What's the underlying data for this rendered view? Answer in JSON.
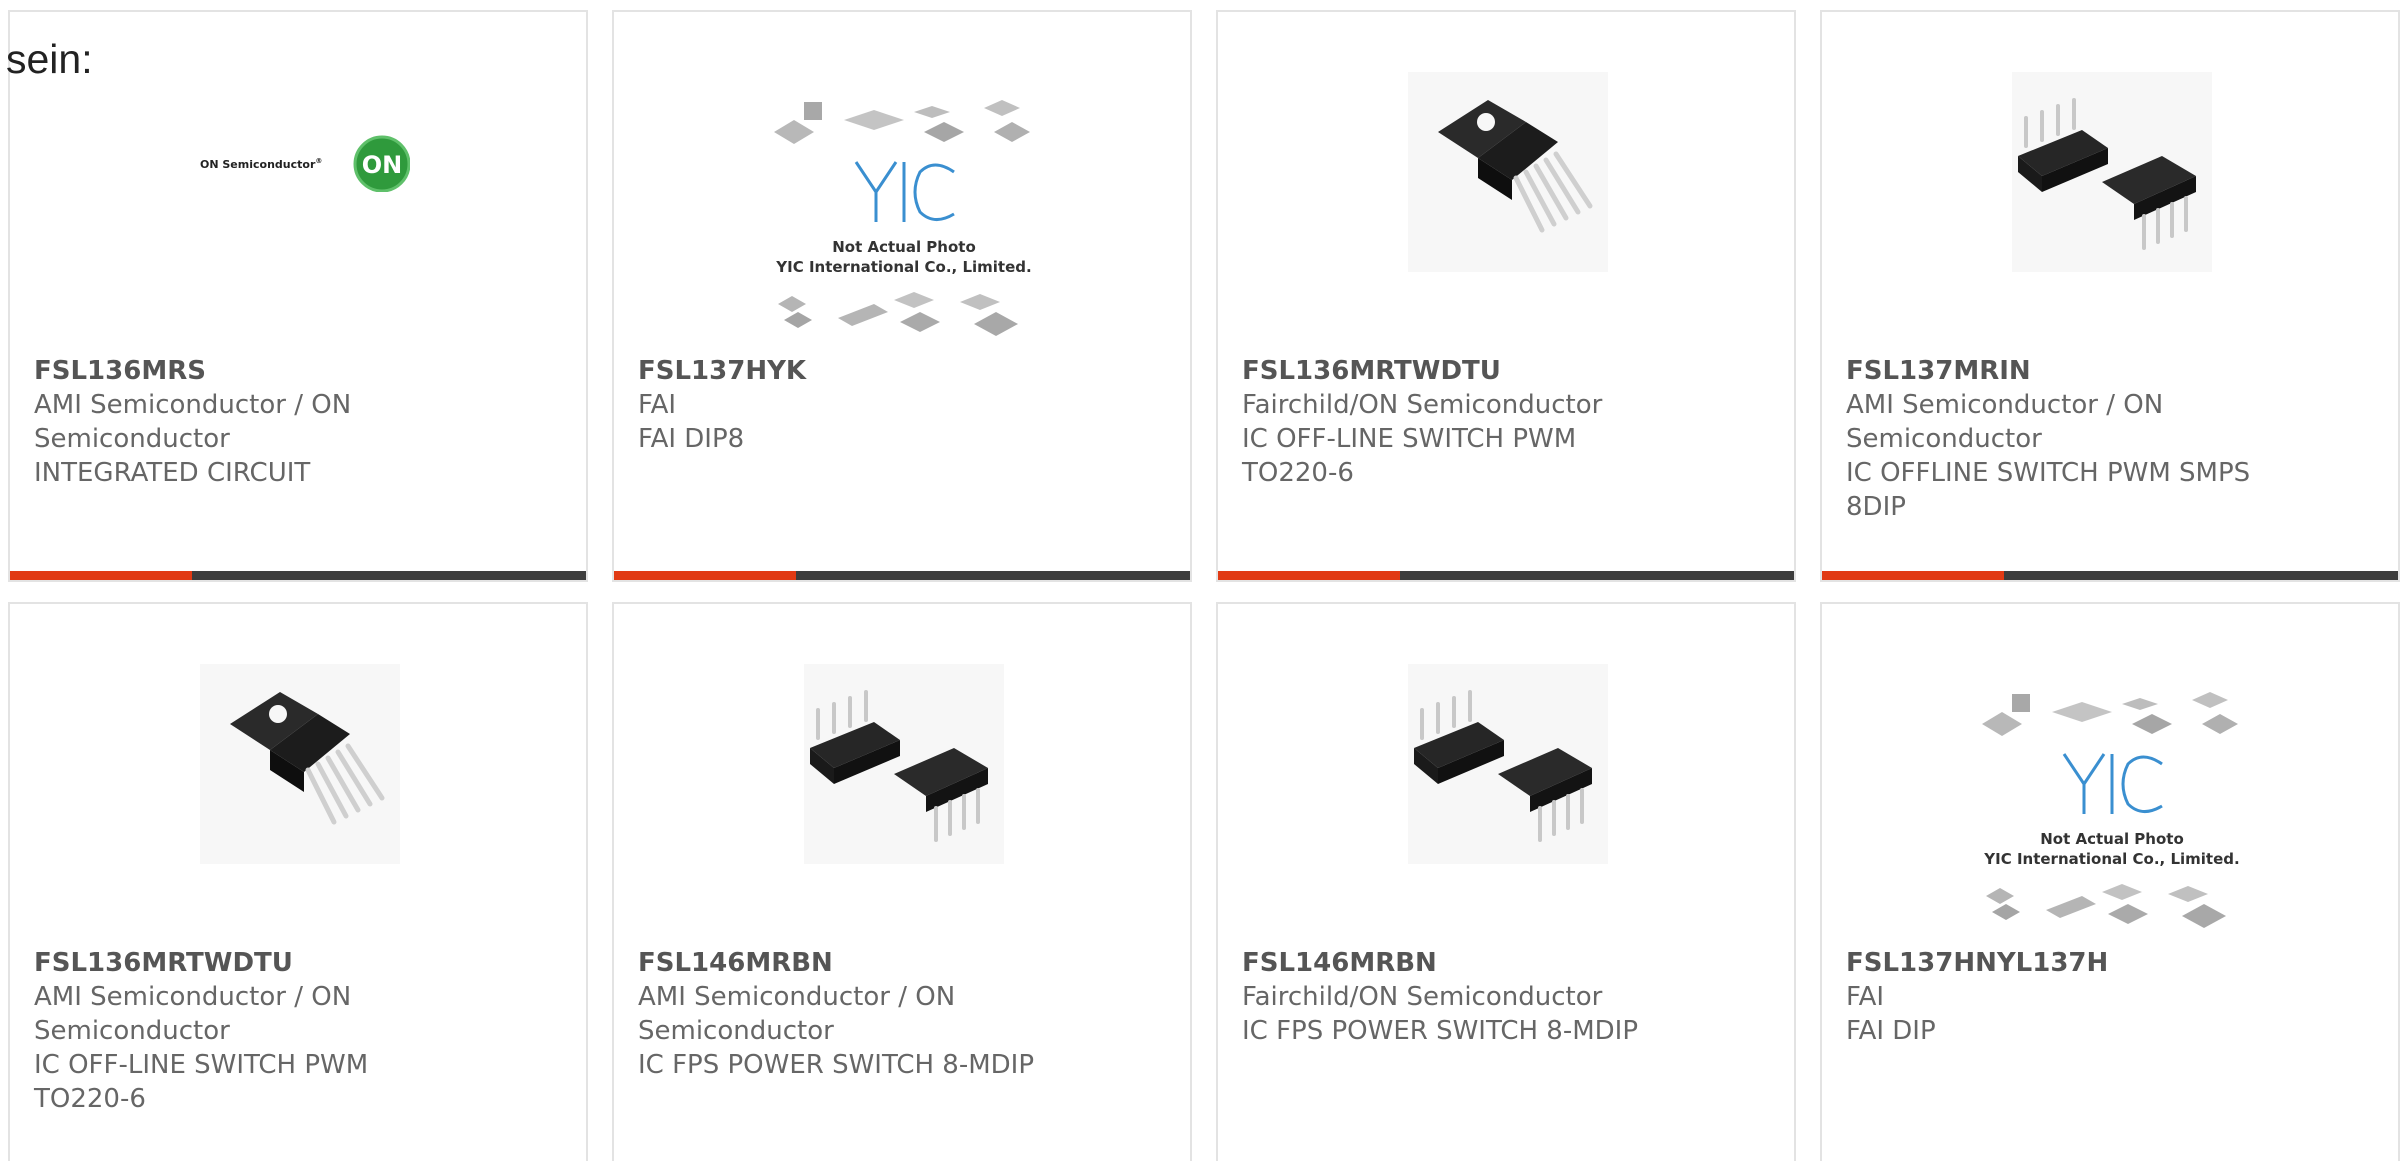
{
  "intro_text": "sein:",
  "products": [
    {
      "part": "FSL136MRS",
      "lines": [
        "AMI Semiconductor / ON",
        "Semiconductor",
        "INTEGRATED CIRCUIT"
      ],
      "image": "on-semiconductor-logo",
      "logo_text": "ON Semiconductor",
      "logo_badge": "ON"
    },
    {
      "part": "FSL137HYK",
      "lines": [
        "FAI",
        "FAI DIP8"
      ],
      "image": "yic-placeholder",
      "placeholder_brand": "YIC",
      "placeholder_caption_1": "Not Actual Photo",
      "placeholder_caption_2": "YIC International Co., Limited."
    },
    {
      "part": "FSL136MRTWDTU",
      "lines": [
        "Fairchild/ON Semiconductor",
        "IC OFF-LINE SWITCH PWM",
        "TO220-6"
      ],
      "image": "to220-chip"
    },
    {
      "part": "FSL137MRIN",
      "lines": [
        "AMI Semiconductor / ON",
        "Semiconductor",
        "IC OFFLINE SWITCH PWM SMPS",
        "8DIP"
      ],
      "image": "dip8-chips"
    },
    {
      "part": "FSL136MRTWDTU",
      "lines": [
        "AMI Semiconductor / ON",
        "Semiconductor",
        "IC OFF-LINE SWITCH PWM",
        "TO220-6"
      ],
      "image": "to220-chip"
    },
    {
      "part": "FSL146MRBN",
      "lines": [
        "AMI Semiconductor / ON",
        "Semiconductor",
        "IC FPS POWER SWITCH 8-MDIP"
      ],
      "image": "dip8-chips"
    },
    {
      "part": "FSL146MRBN",
      "lines": [
        "Fairchild/ON Semiconductor",
        "IC FPS POWER SWITCH 8-MDIP"
      ],
      "image": "dip8-chips"
    },
    {
      "part": "FSL137HNYL137H",
      "lines": [
        "FAI",
        "FAI DIP"
      ],
      "image": "yic-placeholder",
      "placeholder_brand": "YIC",
      "placeholder_caption_1": "Not Actual Photo",
      "placeholder_caption_2": "YIC International Co., Limited."
    }
  ],
  "colors": {
    "accent": "#e13a14",
    "bar": "#3d3d3d",
    "card_border": "#e3e3e3",
    "text": "#666666",
    "on_logo_green": "#2f9a3c",
    "yic_blue": "#3a8fd0"
  }
}
